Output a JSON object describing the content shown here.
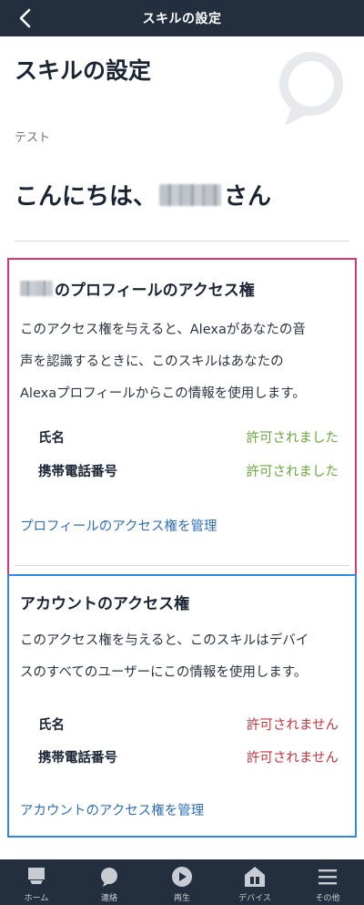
{
  "header": {
    "title": "スキルの設定",
    "back_icon": "chevron-left-icon"
  },
  "main": {
    "page_title": "スキルの設定",
    "skill_name": "テスト",
    "greeting_prefix": "こんにちは、",
    "greeting_suffix": "さん"
  },
  "profile_card": {
    "title_suffix": "のプロフィールのアクセス権",
    "description_lines": [
      "このアクセス権を与えると、Alexaがあなたの音",
      "声を認識するときに、このスキルはあなたの",
      "Alexaプロフィールからこの情報を使用します。"
    ],
    "permissions": [
      {
        "label": "氏名",
        "status": "許可されました"
      },
      {
        "label": "携帯電話番号",
        "status": "許可されました"
      }
    ],
    "manage_link": "プロフィールのアクセス権を管理",
    "status_color": "#6aa83b",
    "border_color": "#e0336b"
  },
  "account_card": {
    "title": "アカウントのアクセス権",
    "description_lines": [
      "このアクセス権を与えると、このスキルはデバイ",
      "スのすべてのユーザーにこの情報を使用します。"
    ],
    "permissions": [
      {
        "label": "氏名",
        "status": "許可されません"
      },
      {
        "label": "携帯電話番号",
        "status": "許可されません"
      }
    ],
    "manage_link": "アカウントのアクセス権を管理",
    "status_color": "#c7353f",
    "border_color": "#2f8ae6"
  },
  "tabbar": {
    "tabs": [
      {
        "label": "ホーム",
        "icon": "home-icon"
      },
      {
        "label": "連絡",
        "icon": "chat-bubble-icon"
      },
      {
        "label": "再生",
        "icon": "play-icon"
      },
      {
        "label": "デバイス",
        "icon": "devices-home-icon"
      },
      {
        "label": "その他",
        "icon": "menu-icon"
      }
    ]
  }
}
